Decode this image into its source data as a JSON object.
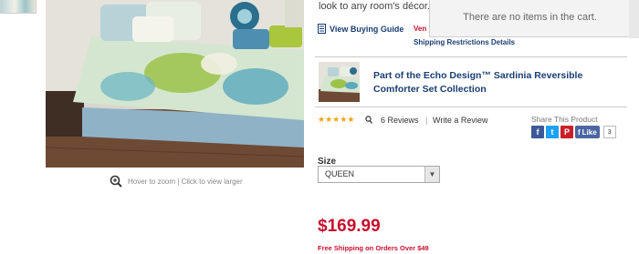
{
  "product": {
    "decor_text": "look to any room's décor.",
    "buying_guide_label": "View Buying Guide",
    "vendor_label": "Ven",
    "shipping_restrictions_label": "Shipping Restrictions Details"
  },
  "cart": {
    "empty_message": "There are no items in the cart."
  },
  "image": {
    "zoom_hint": "Hover to zoom | Click to view larger"
  },
  "collection": {
    "text": "Part of the  Echo Design™ Sardinia Reversible Comforter Set  Collection"
  },
  "reviews": {
    "rating": 5,
    "count_label": "6 Reviews",
    "separator": "|",
    "write_label": "Write a Review"
  },
  "share": {
    "label": "Share This Product",
    "like_label": "Like",
    "like_count": "3"
  },
  "size": {
    "label": "Size",
    "selected": "QUEEN"
  },
  "price": {
    "amount": "$169.99",
    "shipping_note": "Free Shipping on Orders Over $49"
  },
  "colors": {
    "price_red": "#c8102e",
    "link_navy": "#1a3e72",
    "star_gold": "#f0a41b"
  }
}
